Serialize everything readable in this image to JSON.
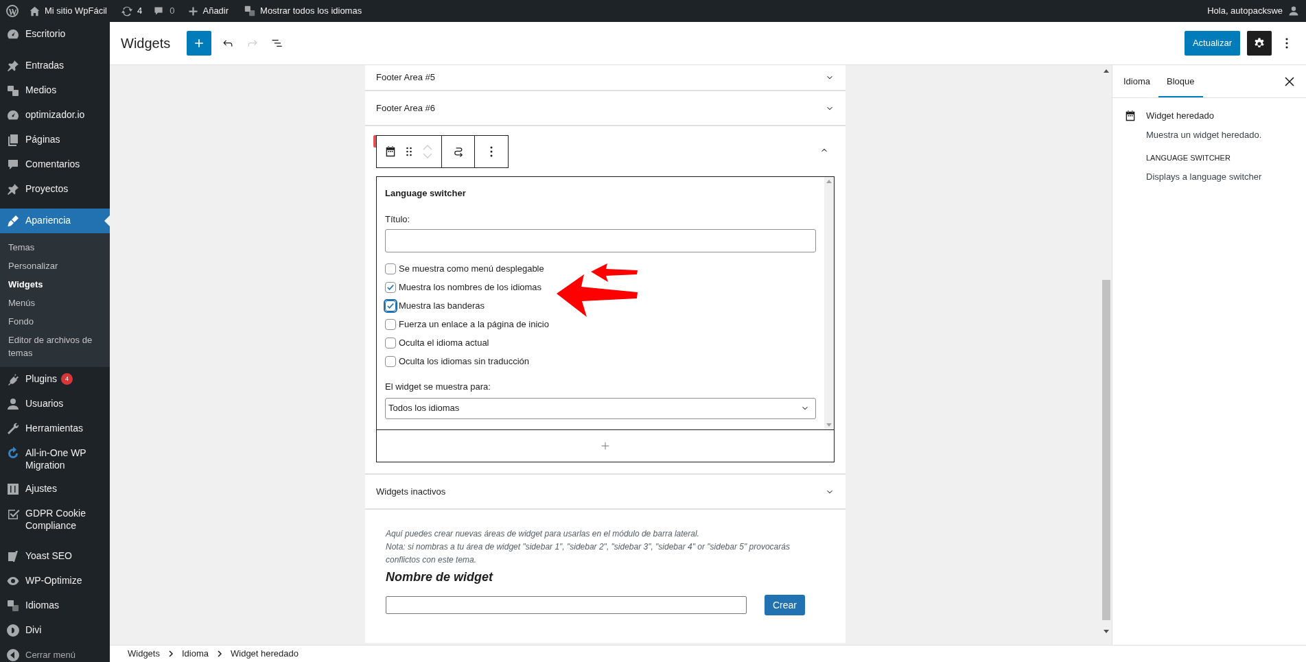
{
  "admin_bar": {
    "site_name": "Mi sitio WpFácil",
    "updates": "4",
    "comments": "0",
    "new": "Añadir",
    "languages": "Mostrar todos los idiomas",
    "greeting": "Hola, autopackswe"
  },
  "sidebar": {
    "items": [
      {
        "label": "Escritorio",
        "selected": false,
        "separator_after": true
      },
      {
        "label": "Entradas",
        "selected": false
      },
      {
        "label": "Medios",
        "selected": false
      },
      {
        "label": "optimizador.io",
        "selected": false
      },
      {
        "label": "Páginas",
        "selected": false
      },
      {
        "label": "Comentarios",
        "selected": false
      },
      {
        "label": "Proyectos",
        "selected": false,
        "separator_after": true
      },
      {
        "label": "Apariencia",
        "selected": true,
        "children": [
          {
            "label": "Temas",
            "selected": false
          },
          {
            "label": "Personalizar",
            "selected": false
          },
          {
            "label": "Widgets",
            "selected": true
          },
          {
            "label": "Menús",
            "selected": false
          },
          {
            "label": "Fondo",
            "selected": false
          },
          {
            "label": "Editor de archivos de temas",
            "selected": false
          }
        ]
      },
      {
        "label": "Plugins",
        "selected": false,
        "badge": "4"
      },
      {
        "label": "Usuarios",
        "selected": false
      },
      {
        "label": "Herramientas",
        "selected": false
      },
      {
        "label": "All-in-One WP Migration",
        "selected": false
      },
      {
        "label": "Ajustes",
        "selected": false
      },
      {
        "label": "GDPR Cookie Compliance",
        "selected": false,
        "separator_after": true
      },
      {
        "label": "Yoast SEO",
        "selected": false
      },
      {
        "label": "WP-Optimize",
        "selected": false
      },
      {
        "label": "Idiomas",
        "selected": false
      },
      {
        "label": "Divi",
        "selected": false
      }
    ],
    "collapse": "Cerrar menú"
  },
  "header": {
    "title": "Widgets",
    "redo_disabled": true,
    "update_button": "Actualizar",
    "settings_pressed": true
  },
  "widget_areas": [
    {
      "title": "Footer Area #5",
      "expanded": false
    },
    {
      "title": "Footer Area #6",
      "expanded": false
    },
    {
      "expanded": true,
      "block": {
        "title": "Language switcher",
        "title_field": {
          "label": "Título:"
        },
        "options": [
          {
            "label": "Se muestra como menú desplegable",
            "checked": false,
            "focused": false
          },
          {
            "label": "Muestra los nombres de los idiomas",
            "checked": true,
            "focused": false
          },
          {
            "label": "Muestra las banderas",
            "checked": true,
            "focused": true
          },
          {
            "label": "Fuerza un enlace a la página de inicio",
            "checked": false,
            "focused": false
          },
          {
            "label": "Oculta el idioma actual",
            "checked": false,
            "focused": false
          },
          {
            "label": "Oculta los idiomas sin traducción",
            "checked": false,
            "focused": false
          }
        ],
        "visibility": {
          "label": "El widget se muestra para:",
          "value": "Todos los idiomas"
        }
      }
    },
    {
      "title": "Widgets inactivos",
      "expanded": false
    }
  ],
  "create_area": {
    "description": "Aquí puedes crear nuevas áreas de widget para usarlas en el módulo de barra lateral.",
    "note": "Nota: si nombras a tu área de widget \"sidebar 1\", \"sidebar 2\", \"sidebar 3\", \"sidebar 4\" or \"sidebar 5\" provocarás conflictos con este tema.",
    "heading": "Nombre de widget",
    "button": "Crear"
  },
  "inspector": {
    "tabs": [
      {
        "label": "Idioma",
        "selected": false
      },
      {
        "label": "Bloque",
        "selected": true
      }
    ],
    "block_name": "Widget heredado",
    "block_description": "Muestra un widget heredado.",
    "widget_title": "LANGUAGE SWITCHER",
    "widget_description": "Displays a language switcher"
  },
  "breadcrumb": [
    "Widgets",
    "Idioma",
    "Widget heredado"
  ]
}
